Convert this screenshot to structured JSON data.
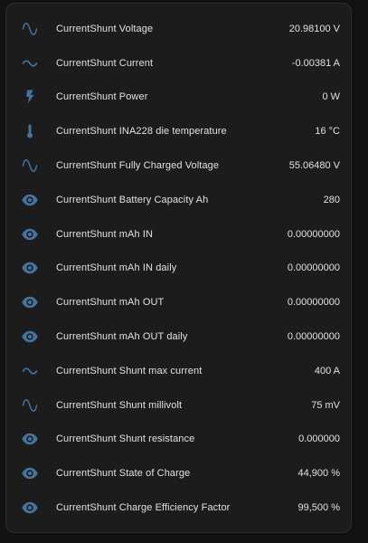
{
  "colors": {
    "icon": "#44739e",
    "card_background": "#1c1c1c",
    "page_background": "#111111",
    "text": "#e1e1e1"
  },
  "entities": [
    {
      "icon": "sine-wave-icon",
      "name": "CurrentShunt Voltage",
      "value": "20.98100 V"
    },
    {
      "icon": "current-ac-icon",
      "name": "CurrentShunt Current",
      "value": "-0.00381 A"
    },
    {
      "icon": "flash-icon",
      "name": "CurrentShunt Power",
      "value": "0 W"
    },
    {
      "icon": "thermometer-icon",
      "name": "CurrentShunt INA228 die temperature",
      "value": "16 °C"
    },
    {
      "icon": "sine-wave-icon",
      "name": "CurrentShunt Fully Charged Voltage",
      "value": "55.06480 V"
    },
    {
      "icon": "eye-icon",
      "name": "CurrentShunt Battery Capacity Ah",
      "value": "280"
    },
    {
      "icon": "eye-icon",
      "name": "CurrentShunt mAh IN",
      "value": "0.00000000"
    },
    {
      "icon": "eye-icon",
      "name": "CurrentShunt mAh IN daily",
      "value": "0.00000000"
    },
    {
      "icon": "eye-icon",
      "name": "CurrentShunt mAh OUT",
      "value": "0.00000000"
    },
    {
      "icon": "eye-icon",
      "name": "CurrentShunt mAh OUT daily",
      "value": "0.00000000"
    },
    {
      "icon": "current-ac-icon",
      "name": "CurrentShunt Shunt max current",
      "value": "400 A"
    },
    {
      "icon": "sine-wave-icon",
      "name": "CurrentShunt Shunt millivolt",
      "value": "75 mV"
    },
    {
      "icon": "eye-icon",
      "name": "CurrentShunt Shunt resistance",
      "value": "0.000000"
    },
    {
      "icon": "eye-icon",
      "name": "CurrentShunt State of Charge",
      "value": "44,900 %"
    },
    {
      "icon": "eye-icon",
      "name": "CurrentShunt Charge Efficiency Factor",
      "value": "99,500 %"
    }
  ]
}
